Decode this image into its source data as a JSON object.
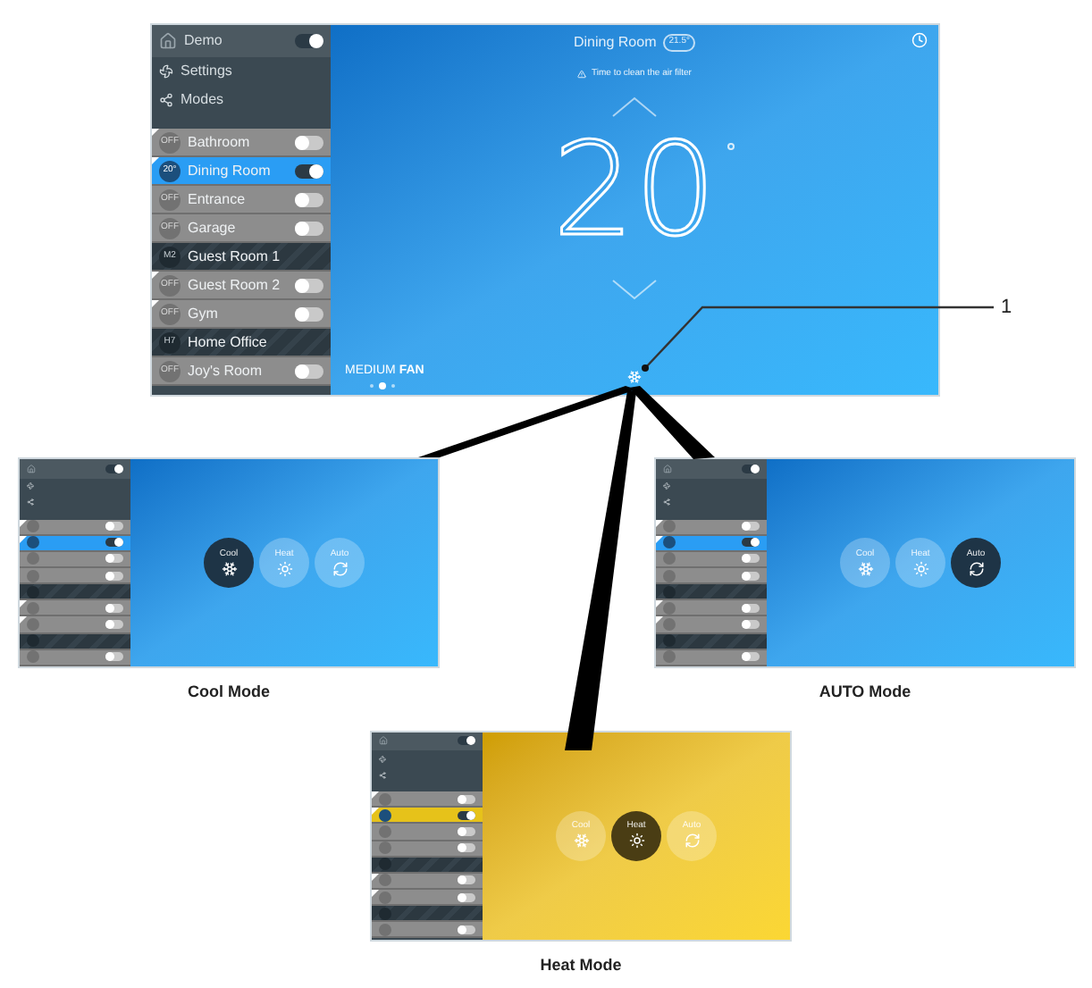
{
  "main_screen": {
    "kind": "cool",
    "header": {
      "label": "Demo",
      "on": true
    },
    "menu": [
      {
        "label": "Settings",
        "kind": "settings"
      },
      {
        "label": "Modes",
        "kind": "modes"
      }
    ],
    "rooms": [
      {
        "label": "Bathroom",
        "badge": "OFF",
        "kind": "room",
        "alert": true,
        "on": false,
        "selected": false
      },
      {
        "label": "Dining Room",
        "badge": "20°",
        "kind": "room",
        "alert": true,
        "on": true,
        "selected": true
      },
      {
        "label": "Entrance",
        "badge": "OFF",
        "kind": "room",
        "alert": false,
        "on": false,
        "selected": false
      },
      {
        "label": "Garage",
        "badge": "OFF",
        "kind": "room",
        "alert": false,
        "on": false,
        "selected": false
      },
      {
        "label": "Guest Room 1",
        "badge": "M2",
        "kind": "group",
        "alert": false,
        "selected": false
      },
      {
        "label": "Guest Room 2",
        "badge": "OFF",
        "kind": "room",
        "alert": true,
        "on": false,
        "selected": false
      },
      {
        "label": "Gym",
        "badge": "OFF",
        "kind": "room",
        "alert": true,
        "on": false,
        "selected": false
      },
      {
        "label": "Home Office",
        "badge": "H7",
        "kind": "group",
        "alert": false,
        "selected": false
      },
      {
        "label": "Joy's Room",
        "badge": "OFF",
        "kind": "room",
        "alert": false,
        "on": false,
        "selected": false
      }
    ],
    "title": "Dining Room",
    "title_badge": "21.5°",
    "alert": "Time to clean the air filter",
    "setpoint": "20",
    "fan": "MEDIUM **FAN**",
    "pages": [
      {
        "selected": false
      },
      {
        "selected": true
      },
      {
        "selected": false
      }
    ]
  },
  "callout": "1",
  "mode_screens": [
    {
      "caption": "Cool Mode",
      "kind": "cool",
      "modes": [
        {
          "label": "Cool",
          "kind": "cool",
          "selected": true
        },
        {
          "label": "Heat",
          "kind": "heat",
          "selected": false
        },
        {
          "label": "Auto",
          "kind": "auto",
          "selected": false
        }
      ]
    },
    {
      "caption": "AUTO Mode",
      "kind": "cool",
      "modes": [
        {
          "label": "Cool",
          "kind": "cool",
          "selected": false
        },
        {
          "label": "Heat",
          "kind": "heat",
          "selected": false
        },
        {
          "label": "Auto",
          "kind": "auto",
          "selected": true
        }
      ]
    },
    {
      "caption": "Heat Mode",
      "kind": "heat",
      "modes": [
        {
          "label": "Cool",
          "kind": "cool",
          "selected": false
        },
        {
          "label": "Heat",
          "kind": "heat",
          "selected": true
        },
        {
          "label": "Auto",
          "kind": "auto",
          "selected": false
        }
      ]
    }
  ]
}
